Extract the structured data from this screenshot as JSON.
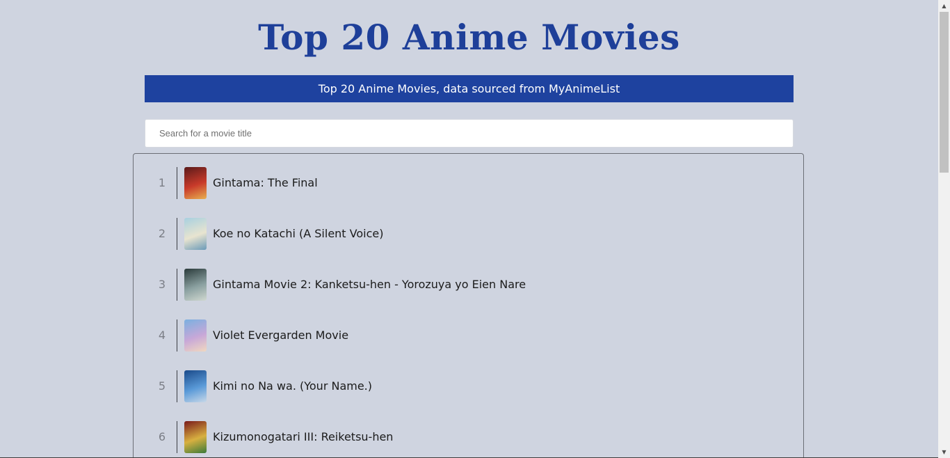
{
  "header": {
    "title": "Top 20 Anime Movies",
    "banner": "Top 20 Anime Movies, data sourced from MyAnimeList"
  },
  "search": {
    "placeholder": "Search for a movie title",
    "value": ""
  },
  "movies": [
    {
      "rank": "1",
      "title": "Gintama: The Final",
      "poster_colors": [
        "#5a1a1a",
        "#c83a2a",
        "#e8b050"
      ]
    },
    {
      "rank": "2",
      "title": "Koe no Katachi (A Silent Voice)",
      "poster_colors": [
        "#a8d0e0",
        "#e8e4d0",
        "#6a9ab8"
      ]
    },
    {
      "rank": "3",
      "title": "Gintama Movie 2: Kanketsu-hen - Yorozuya yo Eien Nare",
      "poster_colors": [
        "#2a3a3a",
        "#8aa0a0",
        "#d0d8d0"
      ]
    },
    {
      "rank": "4",
      "title": "Violet Evergarden Movie",
      "poster_colors": [
        "#7ab0e0",
        "#c8a8d8",
        "#f0d8c0"
      ]
    },
    {
      "rank": "5",
      "title": "Kimi no Na wa. (Your Name.)",
      "poster_colors": [
        "#1a4a8a",
        "#5a9ad8",
        "#c8d8e8"
      ]
    },
    {
      "rank": "6",
      "title": "Kizumonogatari III: Reiketsu-hen",
      "poster_colors": [
        "#7a1a1a",
        "#d8b040",
        "#3a7a3a"
      ]
    }
  ]
}
